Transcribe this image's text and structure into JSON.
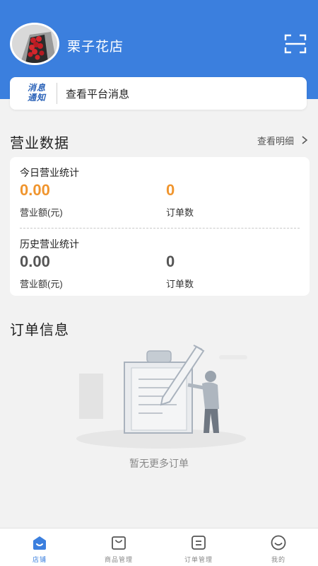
{
  "header": {
    "shop_name": "栗子花店",
    "avatar_icon": "flower-bouquet-avatar",
    "scan_icon": "scan-icon",
    "background": "#3b7fde"
  },
  "notice": {
    "badge_line1": "消息",
    "badge_line2": "通知",
    "text": "查看平台消息"
  },
  "business": {
    "title": "营业数据",
    "detail_link": "查看明细",
    "today": {
      "heading": "今日营业统计",
      "revenue_value": "0.00",
      "revenue_label": "营业额(元)",
      "orders_value": "0",
      "orders_label": "订单数"
    },
    "history": {
      "heading": "历史营业统计",
      "revenue_value": "0.00",
      "revenue_label": "营业额(元)",
      "orders_value": "0",
      "orders_label": "订单数"
    },
    "accent_color": "#f0952e"
  },
  "orders": {
    "title": "订单信息",
    "empty_text": "暂无更多订单"
  },
  "tabbar": {
    "items": [
      {
        "label": "店铺",
        "icon": "shop-icon",
        "active": true
      },
      {
        "label": "商品管理",
        "icon": "bag-icon",
        "active": false
      },
      {
        "label": "订单管理",
        "icon": "order-list-icon",
        "active": false
      },
      {
        "label": "我的",
        "icon": "smiley-icon",
        "active": false
      }
    ],
    "active_color": "#3b7fde"
  }
}
